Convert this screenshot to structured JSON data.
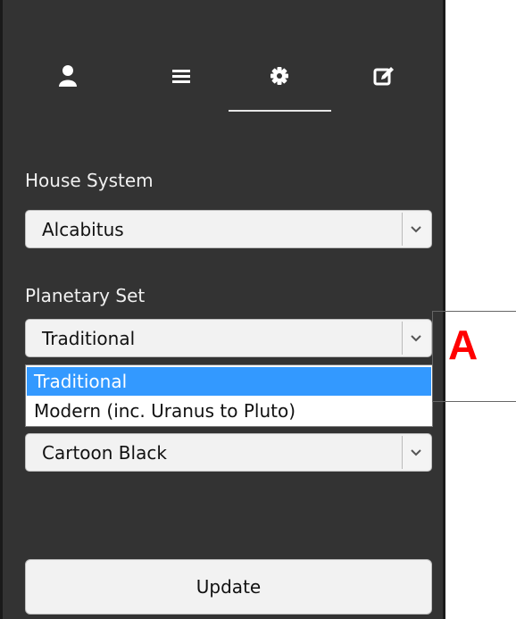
{
  "tabs": [
    {
      "icon": "user-icon"
    },
    {
      "icon": "menu-icon"
    },
    {
      "icon": "gear-icon",
      "active": true
    },
    {
      "icon": "edit-icon"
    }
  ],
  "house_system": {
    "label": "House System",
    "value": "Alcabitus"
  },
  "planetary_set": {
    "label": "Planetary Set",
    "value": "Traditional",
    "options": [
      {
        "label": "Traditional",
        "selected": true
      },
      {
        "label": "Modern (inc. Uranus to Pluto)",
        "selected": false
      }
    ]
  },
  "theme": {
    "value": "Cartoon Black"
  },
  "update_button": {
    "label": "Update"
  },
  "callout": {
    "letter": "A",
    "color": "#ff0000"
  },
  "colors": {
    "panel_bg": "#333333",
    "highlight": "#3399ff"
  }
}
